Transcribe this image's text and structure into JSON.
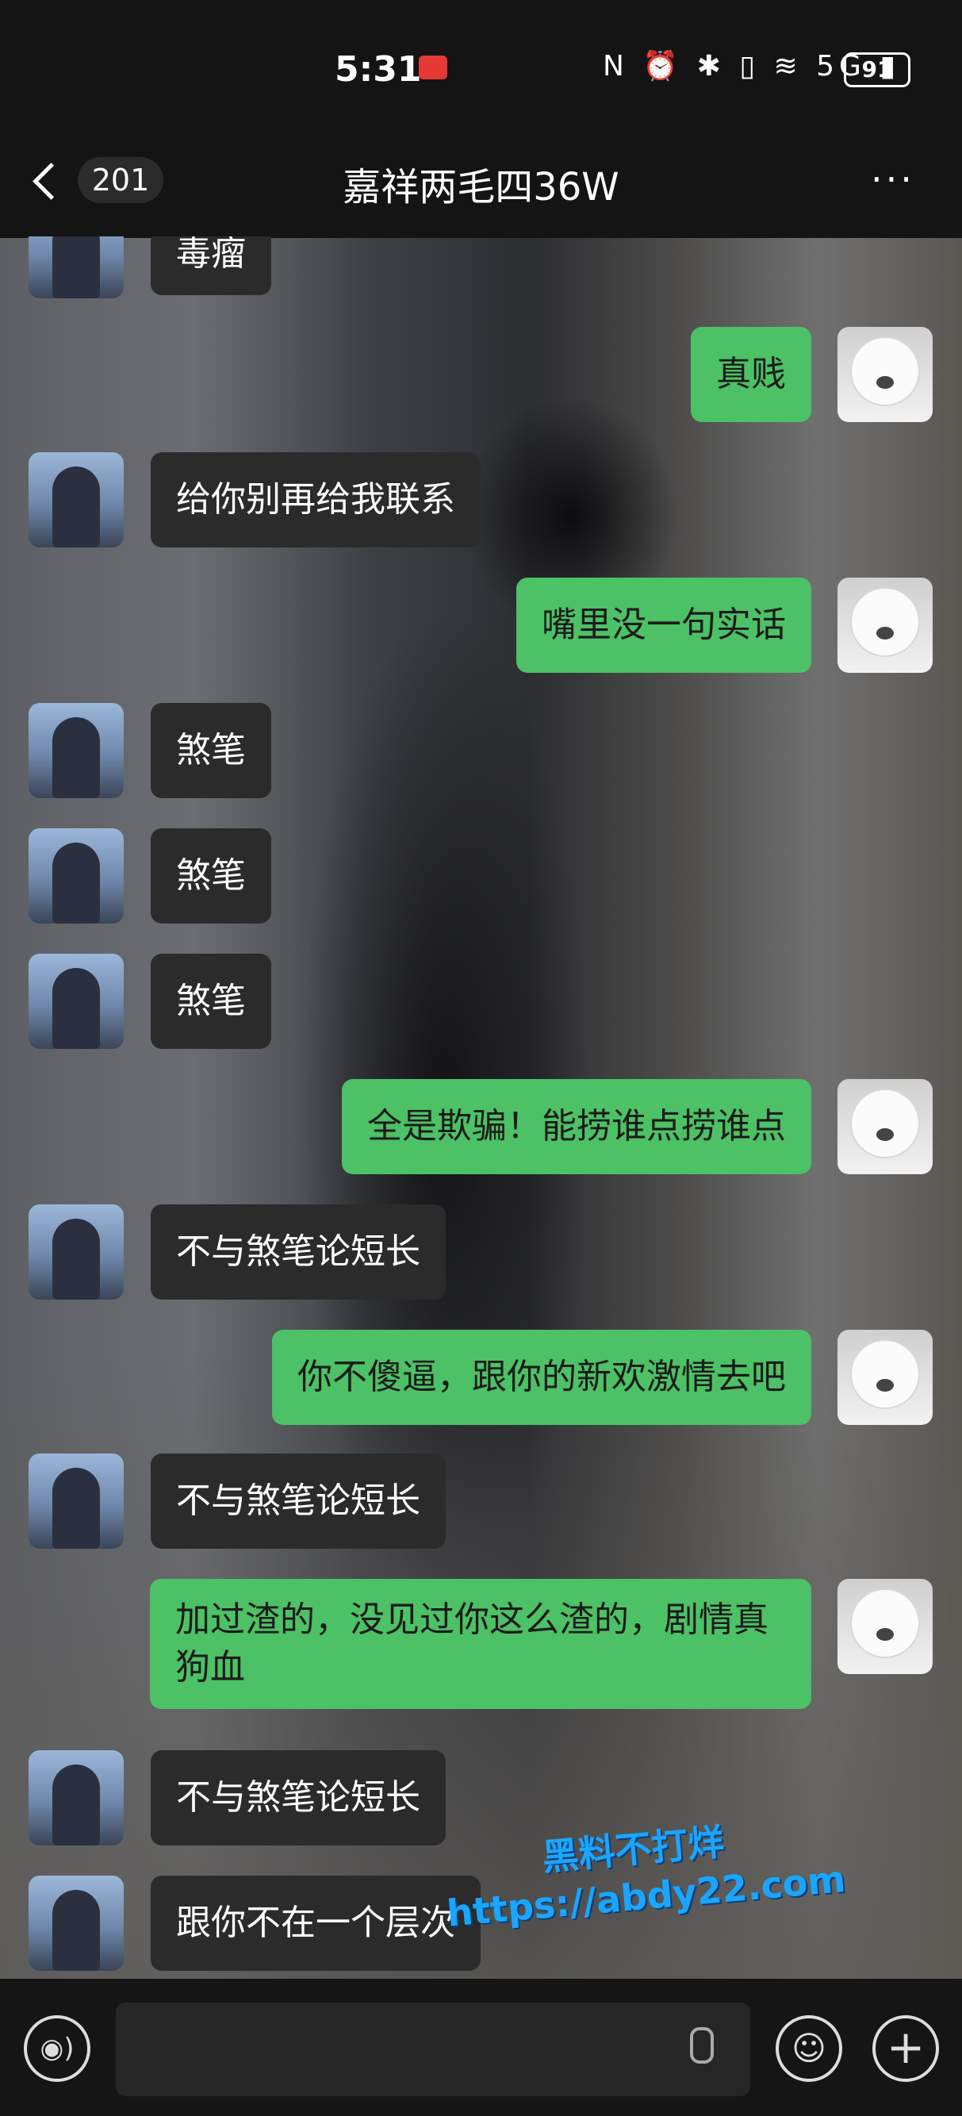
{
  "status_bar": {
    "time": "5:31",
    "icons": "N ⏰ ✱ ▯ ≋ 5G ▮",
    "battery": "91"
  },
  "header": {
    "back_count": "201",
    "title": "嘉祥两毛四36W",
    "more": "···"
  },
  "messages": [
    {
      "side": "other",
      "text": "毒瘤"
    },
    {
      "side": "self",
      "text": "真贱"
    },
    {
      "side": "other",
      "text": "给你别再给我联系"
    },
    {
      "side": "self",
      "text": "嘴里没一句实话"
    },
    {
      "side": "other",
      "text": "煞笔"
    },
    {
      "side": "other",
      "text": "煞笔"
    },
    {
      "side": "other",
      "text": "煞笔"
    },
    {
      "side": "self",
      "text": "全是欺骗！能捞谁点捞谁点"
    },
    {
      "side": "other",
      "text": "不与煞笔论短长"
    },
    {
      "side": "self",
      "text": "你不傻逼，跟你的新欢激情去吧"
    },
    {
      "side": "other",
      "text": "不与煞笔论短长"
    },
    {
      "side": "self",
      "text": "加过渣的，没见过你这么渣的，剧情真狗血"
    },
    {
      "side": "other",
      "text": "不与煞笔论短长"
    },
    {
      "side": "other",
      "text": "跟你不在一个层次"
    }
  ],
  "input_bar": {
    "voice": "◉)",
    "emoji": "☺",
    "plus": "+"
  },
  "watermark": {
    "line1": "黑料不打烊",
    "line2": "https://abdy22.com"
  },
  "colors": {
    "self_bubble": "#4cc165",
    "other_bubble": "#2b2b2b",
    "bar": "#141414"
  }
}
